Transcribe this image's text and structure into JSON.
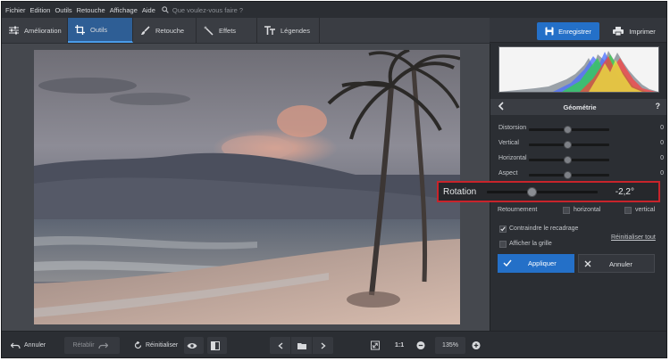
{
  "menu": [
    "Fichier",
    "Edition",
    "Outils",
    "Retouche",
    "Affichage",
    "Aide"
  ],
  "search": {
    "placeholder": "Que voulez-vous faire ?"
  },
  "tabs": [
    {
      "label": "Amélioration",
      "icon": "sliders-icon"
    },
    {
      "label": "Outils",
      "icon": "crop-icon"
    },
    {
      "label": "Retouche",
      "icon": "brush-icon"
    },
    {
      "label": "Effets",
      "icon": "magic-wand-icon"
    },
    {
      "label": "Légendes",
      "icon": "text-icon"
    }
  ],
  "actions": {
    "save": "Enregistrer",
    "print": "Imprimer"
  },
  "panel": {
    "title": "Géométrie",
    "help": "?",
    "sliders": [
      {
        "label": "Distorsion",
        "value": "0",
        "level": 0.5
      },
      {
        "label": "Vertical",
        "value": "0",
        "level": 0.5
      },
      {
        "label": "Horizontal",
        "value": "0",
        "level": 0.5
      },
      {
        "label": "Aspect",
        "value": "0",
        "level": 0.5
      }
    ],
    "rotation": {
      "label": "Rotation",
      "value": "-2,2°",
      "level": 0.42
    },
    "flip": {
      "label": "Retournement",
      "horizontal": "horizontal",
      "vertical": "vertical"
    },
    "constrain": "Contraindre le recadrage",
    "reset_all": "Réinitialiser tout",
    "show_grid": "Afficher la grille",
    "apply": "Appliquer",
    "cancel": "Annuler"
  },
  "bottom": {
    "undo": "Annuler",
    "redo": "Rétablir",
    "reset": "Réinitialiser",
    "ratio": "1:1",
    "zoom": "135%"
  },
  "colors": {
    "accent": "#2470c8",
    "highlight": "#c8242b"
  }
}
